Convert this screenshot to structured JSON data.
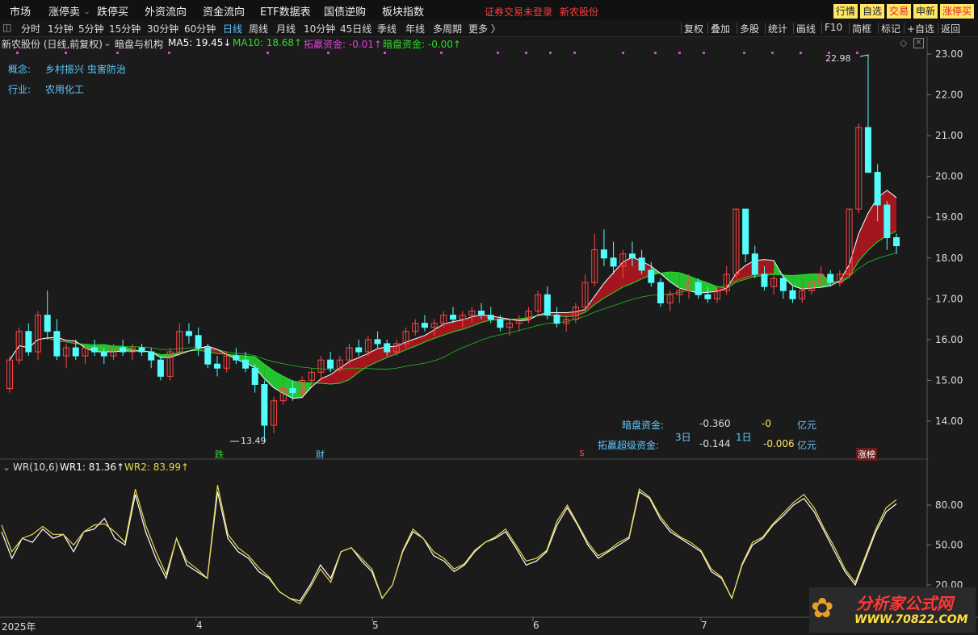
{
  "menu": [
    "市场",
    "涨停卖",
    "跌停买",
    "外资流向",
    "资金流向",
    "ETF数据表",
    "国债逆购",
    "板块指数"
  ],
  "status_text": "证券交易未登录",
  "stock_name_top": "新农股份",
  "right_buttons": [
    {
      "label": "行情",
      "bg": "#ffe666",
      "fg": "#222"
    },
    {
      "label": "自选",
      "bg": "#ffe666",
      "fg": "#222"
    },
    {
      "label": "交易",
      "bg": "#ffe666",
      "fg": "#d22"
    },
    {
      "label": "申新",
      "bg": "#ffe666",
      "fg": "#222"
    },
    {
      "label": "涨停买",
      "bg": "#ffe666",
      "fg": "#d22"
    }
  ],
  "periods": [
    "分时",
    "1分钟",
    "5分钟",
    "15分钟",
    "30分钟",
    "60分钟",
    "日线",
    "周线",
    "月线",
    "10分钟",
    "45日线",
    "季线",
    "年线",
    "多周期",
    "更多 〉"
  ],
  "active_period": "日线",
  "tools": [
    "复权",
    "叠加",
    "多股",
    "统计",
    "画线",
    "F10",
    "简框",
    "标记",
    "+自选",
    "返回"
  ],
  "title": {
    "name": "新农股份 (日线,前复权)",
    "indicator": "暗盘与机构",
    "ma5": "MA5: 19.45↓",
    "ma10": "MA10: 18.68↑",
    "tuoying": "拓赢资金: -0.01↑",
    "anpan": "暗盘资金: -0.00↑"
  },
  "info": {
    "concept_label": "概念:",
    "concept_value": "乡村振兴 虫害防治",
    "industry_label": "行业:",
    "industry_value": "农用化工"
  },
  "annotations": {
    "high": "22.98",
    "low": "13.49",
    "anpan_label": "暗盘资金:",
    "tuoying_label": "拓赢超级资金:",
    "d3": "3日",
    "d1": "1日",
    "anpan_3d": "-0.360",
    "anpan_1d": "-0",
    "tuoying_3d": "-0.144",
    "tuoying_1d": "-0.006",
    "unit": "亿元",
    "bottom_tags": [
      "跌",
      "财",
      "$",
      "涨榜"
    ]
  },
  "wr_title": {
    "name": "WR(10,6)",
    "wr1": "WR1: 81.36↑",
    "wr2": "WR2: 83.99↑"
  },
  "x_axis": {
    "year": "2025年",
    "months": [
      "4",
      "5",
      "6",
      "7"
    ]
  },
  "watermark": {
    "cn": "分析家公式网",
    "url": "WWW.70822.COM"
  },
  "colors": {
    "up": "#ff4646",
    "down": "#54fcfc",
    "ma5": "#ffffff",
    "ma10": "#2bdc2b",
    "ribbon_up": "#a4161d",
    "ribbon_down": "#22c32e",
    "wr1": "#ffffff",
    "wr2": "#e8d84a"
  },
  "chart_data": [
    {
      "type": "candlestick",
      "title": "新农股份 (日线,前复权)",
      "ylim": [
        13.2,
        23.2
      ],
      "y_ticks": [
        "23.00",
        "22.00",
        "21.00",
        "20.00",
        "19.00",
        "18.00",
        "17.00",
        "16.00",
        "15.00",
        "14.00"
      ],
      "ohlc": [
        [
          14.8,
          15.6,
          14.7,
          15.5
        ],
        [
          15.5,
          16.3,
          15.4,
          16.2
        ],
        [
          16.2,
          16.4,
          15.6,
          15.7
        ],
        [
          15.7,
          16.7,
          15.5,
          16.6
        ],
        [
          16.6,
          17.2,
          16.0,
          16.2
        ],
        [
          16.2,
          16.5,
          15.5,
          15.6
        ],
        [
          15.6,
          15.9,
          15.3,
          15.8
        ],
        [
          15.8,
          16.0,
          15.5,
          15.6
        ],
        [
          15.6,
          15.9,
          15.4,
          15.8
        ],
        [
          15.8,
          16.0,
          15.6,
          15.7
        ],
        [
          15.7,
          15.8,
          15.4,
          15.6
        ],
        [
          15.6,
          15.9,
          15.5,
          15.8
        ],
        [
          15.8,
          16.0,
          15.6,
          15.7
        ],
        [
          15.7,
          15.9,
          15.5,
          15.8
        ],
        [
          15.8,
          15.9,
          15.6,
          15.7
        ],
        [
          15.7,
          15.8,
          15.3,
          15.5
        ],
        [
          15.5,
          15.6,
          15.0,
          15.1
        ],
        [
          15.1,
          15.8,
          15.0,
          15.7
        ],
        [
          15.7,
          16.4,
          15.6,
          16.2
        ],
        [
          16.2,
          16.4,
          15.9,
          16.1
        ],
        [
          16.1,
          16.3,
          15.6,
          15.8
        ],
        [
          15.8,
          15.9,
          15.3,
          15.4
        ],
        [
          15.4,
          15.6,
          15.1,
          15.3
        ],
        [
          15.3,
          15.7,
          15.2,
          15.6
        ],
        [
          15.6,
          15.8,
          15.4,
          15.5
        ],
        [
          15.5,
          15.7,
          15.2,
          15.3
        ],
        [
          15.3,
          15.4,
          14.7,
          14.9
        ],
        [
          14.9,
          15.0,
          13.49,
          13.9
        ],
        [
          13.9,
          14.6,
          13.7,
          14.5
        ],
        [
          14.5,
          14.9,
          14.4,
          14.8
        ],
        [
          14.8,
          15.0,
          14.5,
          14.7
        ],
        [
          14.7,
          15.1,
          14.6,
          15.0
        ],
        [
          15.0,
          15.3,
          14.9,
          15.2
        ],
        [
          15.2,
          15.6,
          15.0,
          15.5
        ],
        [
          15.5,
          15.7,
          15.2,
          15.3
        ],
        [
          15.3,
          15.6,
          15.2,
          15.5
        ],
        [
          15.5,
          15.9,
          15.4,
          15.8
        ],
        [
          15.8,
          16.0,
          15.6,
          15.7
        ],
        [
          15.7,
          16.1,
          15.6,
          16.0
        ],
        [
          16.0,
          16.2,
          15.8,
          15.9
        ],
        [
          15.9,
          16.0,
          15.6,
          15.7
        ],
        [
          15.7,
          16.0,
          15.6,
          15.9
        ],
        [
          15.9,
          16.3,
          15.8,
          16.2
        ],
        [
          16.2,
          16.5,
          16.1,
          16.4
        ],
        [
          16.4,
          16.6,
          16.2,
          16.3
        ],
        [
          16.3,
          16.5,
          16.1,
          16.4
        ],
        [
          16.4,
          16.7,
          16.3,
          16.6
        ],
        [
          16.6,
          16.8,
          16.4,
          16.5
        ],
        [
          16.5,
          16.7,
          16.3,
          16.6
        ],
        [
          16.6,
          16.8,
          16.4,
          16.7
        ],
        [
          16.7,
          16.9,
          16.5,
          16.6
        ],
        [
          16.6,
          16.8,
          16.4,
          16.5
        ],
        [
          16.5,
          16.6,
          16.2,
          16.3
        ],
        [
          16.3,
          16.5,
          16.1,
          16.4
        ],
        [
          16.4,
          16.6,
          16.2,
          16.5
        ],
        [
          16.5,
          16.8,
          16.4,
          16.7
        ],
        [
          16.7,
          17.2,
          16.6,
          17.1
        ],
        [
          17.1,
          17.3,
          16.5,
          16.6
        ],
        [
          16.6,
          16.8,
          16.3,
          16.4
        ],
        [
          16.4,
          16.6,
          16.2,
          16.5
        ],
        [
          16.5,
          16.9,
          16.4,
          16.8
        ],
        [
          16.8,
          17.6,
          16.7,
          17.4
        ],
        [
          17.4,
          18.6,
          17.3,
          18.2
        ],
        [
          18.2,
          18.7,
          17.8,
          18.0
        ],
        [
          18.0,
          18.4,
          17.6,
          17.8
        ],
        [
          17.8,
          18.2,
          17.5,
          18.1
        ],
        [
          18.1,
          18.4,
          17.8,
          18.0
        ],
        [
          18.0,
          18.2,
          17.6,
          17.7
        ],
        [
          17.7,
          17.9,
          17.3,
          17.4
        ],
        [
          17.4,
          17.5,
          16.8,
          16.9
        ],
        [
          16.9,
          17.2,
          16.7,
          17.1
        ],
        [
          17.1,
          17.4,
          16.9,
          17.2
        ],
        [
          17.2,
          17.6,
          17.0,
          17.4
        ],
        [
          17.4,
          17.5,
          17.0,
          17.1
        ],
        [
          17.1,
          17.3,
          16.9,
          17.0
        ],
        [
          17.0,
          17.3,
          16.9,
          17.2
        ],
        [
          17.2,
          17.8,
          17.1,
          17.6
        ],
        [
          17.6,
          19.2,
          17.5,
          19.2
        ],
        [
          19.2,
          19.2,
          17.9,
          18.1
        ],
        [
          18.1,
          18.3,
          17.5,
          17.6
        ],
        [
          17.6,
          17.8,
          17.2,
          17.3
        ],
        [
          17.3,
          17.6,
          17.1,
          17.5
        ],
        [
          17.5,
          17.6,
          17.0,
          17.2
        ],
        [
          17.2,
          17.3,
          16.9,
          17.0
        ],
        [
          17.0,
          17.3,
          16.9,
          17.2
        ],
        [
          17.2,
          17.5,
          17.1,
          17.4
        ],
        [
          17.4,
          17.8,
          17.3,
          17.6
        ],
        [
          17.6,
          17.7,
          17.3,
          17.4
        ],
        [
          17.4,
          17.7,
          17.3,
          17.6
        ],
        [
          17.6,
          19.2,
          17.5,
          19.2
        ],
        [
          19.2,
          21.3,
          19.1,
          21.2
        ],
        [
          21.2,
          22.98,
          20.5,
          20.1
        ],
        [
          20.1,
          20.3,
          18.9,
          19.3
        ],
        [
          19.3,
          19.4,
          18.2,
          18.5
        ],
        [
          18.5,
          18.6,
          18.1,
          18.3
        ]
      ]
    },
    {
      "type": "line",
      "title": "WR(10,6)",
      "ylim": [
        0,
        100
      ],
      "y_ticks": [
        "80.00",
        "50.00",
        "20.00"
      ],
      "series": [
        {
          "name": "WR1",
          "values": [
            60,
            40,
            55,
            52,
            62,
            55,
            58,
            45,
            60,
            62,
            70,
            55,
            50,
            88,
            60,
            40,
            25,
            55,
            35,
            30,
            25,
            90,
            55,
            45,
            40,
            30,
            25,
            15,
            10,
            8,
            20,
            35,
            25,
            45,
            48,
            38,
            30,
            10,
            20,
            45,
            60,
            55,
            42,
            38,
            30,
            35,
            45,
            52,
            55,
            60,
            48,
            35,
            38,
            45,
            65,
            78,
            65,
            50,
            40,
            45,
            50,
            55,
            90,
            85,
            70,
            60,
            55,
            50,
            45,
            30,
            25,
            10,
            35,
            50,
            55,
            65,
            72,
            80,
            85,
            75,
            60,
            45,
            30,
            20,
            40,
            60,
            75,
            81
          ]
        },
        {
          "name": "WR2",
          "values": [
            65,
            45,
            55,
            58,
            64,
            58,
            58,
            50,
            60,
            65,
            66,
            60,
            52,
            92,
            65,
            45,
            28,
            55,
            38,
            32,
            25,
            95,
            58,
            48,
            42,
            33,
            26,
            15,
            10,
            6,
            18,
            32,
            22,
            45,
            48,
            40,
            32,
            10,
            20,
            46,
            62,
            55,
            45,
            40,
            32,
            36,
            46,
            52,
            56,
            62,
            50,
            38,
            40,
            46,
            68,
            80,
            66,
            52,
            42,
            46,
            52,
            56,
            92,
            86,
            72,
            62,
            56,
            52,
            46,
            32,
            26,
            10,
            36,
            52,
            56,
            66,
            74,
            82,
            88,
            78,
            62,
            48,
            32,
            22,
            42,
            62,
            78,
            84
          ]
        }
      ]
    }
  ]
}
